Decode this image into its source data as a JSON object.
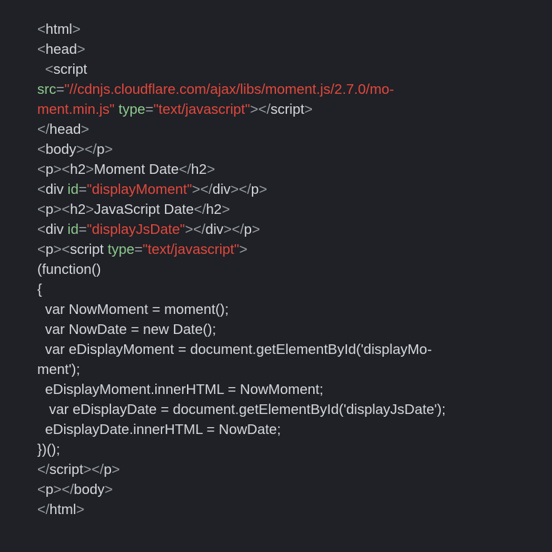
{
  "code": {
    "tokens": [
      {
        "c": "p",
        "v": "<"
      },
      {
        "c": "t",
        "v": "html"
      },
      {
        "c": "p",
        "v": ">"
      },
      {
        "c": "t",
        "v": "\n"
      },
      {
        "c": "p",
        "v": "<"
      },
      {
        "c": "t",
        "v": "head"
      },
      {
        "c": "p",
        "v": ">"
      },
      {
        "c": "t",
        "v": "\n"
      },
      {
        "c": "t",
        "v": "  "
      },
      {
        "c": "p",
        "v": "<"
      },
      {
        "c": "t",
        "v": "script\n"
      },
      {
        "c": "a",
        "v": "src"
      },
      {
        "c": "p",
        "v": "="
      },
      {
        "c": "s",
        "v": "\"//cdnjs.cloudflare.com/ajax/libs/moment.js/2.7.0/mo-\nment.min.js\""
      },
      {
        "c": "t",
        "v": " "
      },
      {
        "c": "a",
        "v": "type"
      },
      {
        "c": "p",
        "v": "="
      },
      {
        "c": "s",
        "v": "\"text/javascript\""
      },
      {
        "c": "p",
        "v": ">"
      },
      {
        "c": "p",
        "v": "</"
      },
      {
        "c": "t",
        "v": "script"
      },
      {
        "c": "p",
        "v": ">"
      },
      {
        "c": "t",
        "v": "\n"
      },
      {
        "c": "p",
        "v": "</"
      },
      {
        "c": "t",
        "v": "head"
      },
      {
        "c": "p",
        "v": ">"
      },
      {
        "c": "t",
        "v": "\n"
      },
      {
        "c": "p",
        "v": "<"
      },
      {
        "c": "t",
        "v": "body"
      },
      {
        "c": "p",
        "v": ">"
      },
      {
        "c": "p",
        "v": "</"
      },
      {
        "c": "t",
        "v": "p"
      },
      {
        "c": "p",
        "v": ">"
      },
      {
        "c": "t",
        "v": "\n"
      },
      {
        "c": "p",
        "v": "<"
      },
      {
        "c": "t",
        "v": "p"
      },
      {
        "c": "p",
        "v": ">"
      },
      {
        "c": "p",
        "v": "<"
      },
      {
        "c": "t",
        "v": "h2"
      },
      {
        "c": "p",
        "v": ">"
      },
      {
        "c": "t",
        "v": "Moment Date"
      },
      {
        "c": "p",
        "v": "</"
      },
      {
        "c": "t",
        "v": "h2"
      },
      {
        "c": "p",
        "v": ">"
      },
      {
        "c": "t",
        "v": "\n"
      },
      {
        "c": "p",
        "v": "<"
      },
      {
        "c": "t",
        "v": "div "
      },
      {
        "c": "a",
        "v": "id"
      },
      {
        "c": "p",
        "v": "="
      },
      {
        "c": "s",
        "v": "\"displayMoment\""
      },
      {
        "c": "p",
        "v": ">"
      },
      {
        "c": "p",
        "v": "</"
      },
      {
        "c": "t",
        "v": "div"
      },
      {
        "c": "p",
        "v": ">"
      },
      {
        "c": "p",
        "v": "</"
      },
      {
        "c": "t",
        "v": "p"
      },
      {
        "c": "p",
        "v": ">"
      },
      {
        "c": "t",
        "v": "\n"
      },
      {
        "c": "p",
        "v": "<"
      },
      {
        "c": "t",
        "v": "p"
      },
      {
        "c": "p",
        "v": ">"
      },
      {
        "c": "p",
        "v": "<"
      },
      {
        "c": "t",
        "v": "h2"
      },
      {
        "c": "p",
        "v": ">"
      },
      {
        "c": "t",
        "v": "JavaScript Date"
      },
      {
        "c": "p",
        "v": "</"
      },
      {
        "c": "t",
        "v": "h2"
      },
      {
        "c": "p",
        "v": ">"
      },
      {
        "c": "t",
        "v": "\n"
      },
      {
        "c": "p",
        "v": "<"
      },
      {
        "c": "t",
        "v": "div "
      },
      {
        "c": "a",
        "v": "id"
      },
      {
        "c": "p",
        "v": "="
      },
      {
        "c": "s",
        "v": "\"displayJsDate\""
      },
      {
        "c": "p",
        "v": ">"
      },
      {
        "c": "p",
        "v": "</"
      },
      {
        "c": "t",
        "v": "div"
      },
      {
        "c": "p",
        "v": ">"
      },
      {
        "c": "p",
        "v": "</"
      },
      {
        "c": "t",
        "v": "p"
      },
      {
        "c": "p",
        "v": ">"
      },
      {
        "c": "t",
        "v": "\n"
      },
      {
        "c": "p",
        "v": "<"
      },
      {
        "c": "t",
        "v": "p"
      },
      {
        "c": "p",
        "v": ">"
      },
      {
        "c": "p",
        "v": "<"
      },
      {
        "c": "t",
        "v": "script "
      },
      {
        "c": "a",
        "v": "type"
      },
      {
        "c": "p",
        "v": "="
      },
      {
        "c": "s",
        "v": "\"text/javascript\""
      },
      {
        "c": "p",
        "v": ">"
      },
      {
        "c": "t",
        "v": "\n"
      },
      {
        "c": "t",
        "v": "(function()\n"
      },
      {
        "c": "t",
        "v": "{\n"
      },
      {
        "c": "t",
        "v": "  var NowMoment = moment();\n"
      },
      {
        "c": "t",
        "v": "  var NowDate = new Date();\n"
      },
      {
        "c": "t",
        "v": "  var eDisplayMoment = document.getElementById('displayMo-\nment');\n"
      },
      {
        "c": "t",
        "v": "  eDisplayMoment.innerHTML = NowMoment;\n"
      },
      {
        "c": "t",
        "v": "   var eDisplayDate = document.getElementById('displayJsDate');\n"
      },
      {
        "c": "t",
        "v": "  eDisplayDate.innerHTML = NowDate;\n"
      },
      {
        "c": "t",
        "v": "})();\n"
      },
      {
        "c": "p",
        "v": "</"
      },
      {
        "c": "t",
        "v": "script"
      },
      {
        "c": "p",
        "v": ">"
      },
      {
        "c": "p",
        "v": "</"
      },
      {
        "c": "t",
        "v": "p"
      },
      {
        "c": "p",
        "v": ">"
      },
      {
        "c": "t",
        "v": "\n"
      },
      {
        "c": "p",
        "v": "<"
      },
      {
        "c": "t",
        "v": "p"
      },
      {
        "c": "p",
        "v": ">"
      },
      {
        "c": "p",
        "v": "</"
      },
      {
        "c": "t",
        "v": "body"
      },
      {
        "c": "p",
        "v": ">"
      },
      {
        "c": "t",
        "v": "\n"
      },
      {
        "c": "p",
        "v": "</"
      },
      {
        "c": "t",
        "v": "html"
      },
      {
        "c": "p",
        "v": ">"
      }
    ]
  }
}
